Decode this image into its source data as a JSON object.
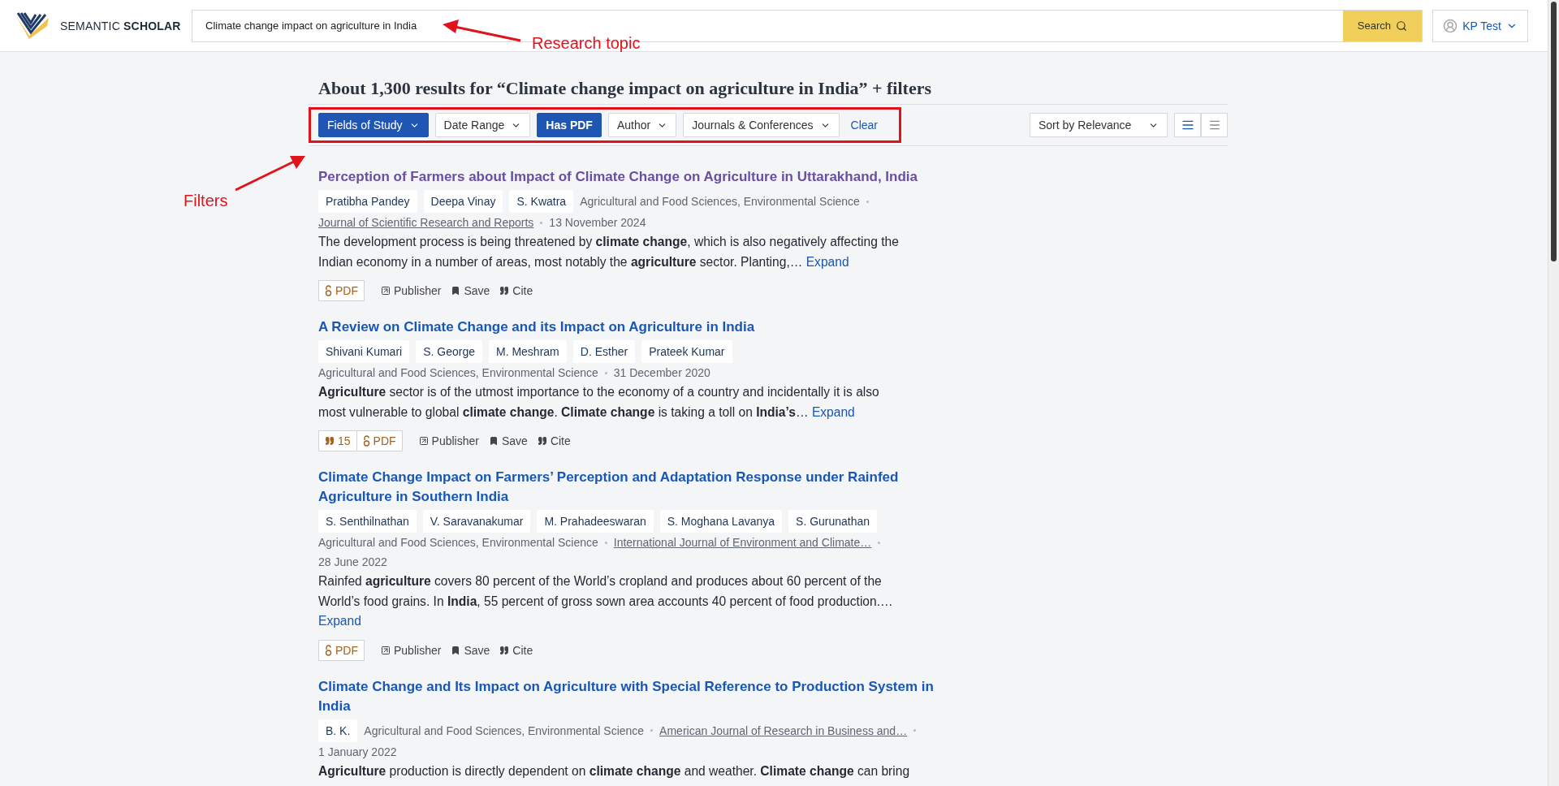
{
  "header": {
    "logo_light": "SEMANTIC",
    "logo_bold": "SCHOLAR",
    "search": {
      "value": "Climate change impact on agriculture in India"
    },
    "search_button": "Search",
    "user_menu": "KP Test"
  },
  "annotations": {
    "search_label": "Research topic",
    "filters_label": "Filters"
  },
  "results_heading": "About 1,300 results for “Climate change impact on agriculture in India” + filters",
  "filters": {
    "highlighted": true,
    "items": [
      {
        "label": "Fields of Study",
        "kind": "dropdown",
        "selected": true
      },
      {
        "label": "Date Range",
        "kind": "dropdown",
        "selected": false
      },
      {
        "label": "Has PDF",
        "kind": "toggle",
        "selected": true
      },
      {
        "label": "Author",
        "kind": "dropdown",
        "selected": false
      },
      {
        "label": "Journals & Conferences",
        "kind": "dropdown",
        "selected": false
      }
    ],
    "clear": "Clear"
  },
  "sort": {
    "value": "Sort by Relevance"
  },
  "view_toggle": [
    {
      "kind": "list",
      "selected": true
    },
    {
      "kind": "compact",
      "selected": false
    }
  ],
  "papers": [
    {
      "title": "Perception of Farmers about Impact of Climate Change on Agriculture in Uttarakhand, India",
      "visited": true,
      "authors": [
        "Pratibha Pandey",
        "Deepa Vinay",
        "S. Kwatra"
      ],
      "meta": [
        {
          "kind": "text",
          "text": "Agricultural and Food Sciences, Environmental Science"
        },
        {
          "kind": "link",
          "text": "Journal of Scientific Research and Reports"
        },
        {
          "kind": "text",
          "text": "13 November 2024"
        }
      ],
      "abstract": [
        "The development process is being threatened by **climate change**, which is also negatively affecting the",
        "Indian economy in a number of areas, most notably the **agriculture** sector. Planting,…"
      ],
      "expand": "Expand",
      "actions": {
        "pdf": "PDF",
        "publisher": "Publisher",
        "save": "Save",
        "cite": "Cite"
      }
    },
    {
      "title": "A Review on Climate Change and its Impact on Agriculture in India",
      "visited": false,
      "authors": [
        "Shivani Kumari",
        "S. George",
        "M. Meshram",
        "D. Esther",
        "Prateek Kumar"
      ],
      "meta": [
        {
          "kind": "text",
          "text": "Agricultural and Food Sciences, Environmental Science"
        },
        {
          "kind": "text",
          "text": "31 December 2020"
        }
      ],
      "abstract": [
        "**Agriculture** sector is of the utmost importance to the economy of a country and incidentally it is also",
        "most vulnerable to global **climate change**. **Climate change** is taking a toll on **India’s**…"
      ],
      "expand": "Expand",
      "actions": {
        "citations": "15",
        "pdf": "PDF",
        "publisher": "Publisher",
        "save": "Save",
        "cite": "Cite"
      }
    },
    {
      "title": "Climate Change Impact on Farmers’ Perception and Adaptation Response under Rainfed Agriculture in Southern India",
      "visited": false,
      "authors": [
        "S. Senthilnathan",
        "V. Saravanakumar",
        "M. Prahadeeswaran",
        "S. Moghana Lavanya",
        "S. Gurunathan"
      ],
      "meta": [
        {
          "kind": "text",
          "text": "Agricultural and Food Sciences, Environmental Science"
        },
        {
          "kind": "link",
          "text": "International Journal of Environment and Climate…"
        },
        {
          "kind": "text",
          "text": "28 June 2022"
        }
      ],
      "abstract": [
        "Rainfed **agriculture** covers 80 percent of the World’s cropland and produces about 60 percent of the",
        "World’s food grains. In **India**, 55 percent of gross sown area accounts 40 percent of food production.…"
      ],
      "expand": "Expand",
      "actions": {
        "pdf": "PDF",
        "publisher": "Publisher",
        "save": "Save",
        "cite": "Cite"
      }
    },
    {
      "title": "Climate Change and Its Impact on Agriculture with Special Reference to Production System in India",
      "visited": false,
      "authors": [
        "B. K."
      ],
      "meta": [
        {
          "kind": "text",
          "text": "Agricultural and Food Sciences, Environmental Science"
        },
        {
          "kind": "link",
          "text": "American Journal of Research in Business and…"
        },
        {
          "kind": "text",
          "text": "1 January 2022"
        }
      ],
      "abstract": [
        "**Agriculture** production is directly dependent on **climate change** and weather. **Climate change** can bring"
      ]
    }
  ]
}
